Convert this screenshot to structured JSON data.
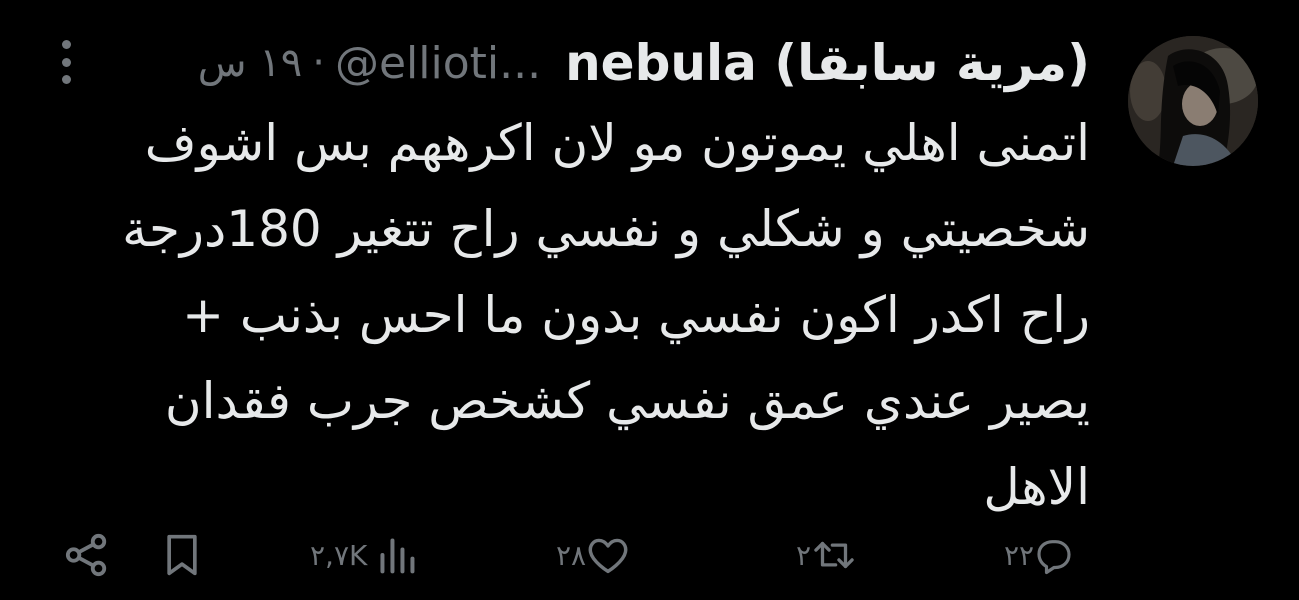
{
  "tweet": {
    "display_name": "nebula (مرية سابقا)",
    "handle": "@ellioti...",
    "separator": "·",
    "time": "١٩ س",
    "body_lines": [
      "اتمنى اهلي يموتون مو لان اكرههم بس اشوف",
      "شخصيتي و شكلي و نفسي راح تتغير 180درجة",
      "راح اكدر اكون نفسي بدون ما احس بذنب +",
      "يصير عندي عمق نفسي كشخص جرب فقدان",
      "الاهل"
    ]
  },
  "actions": {
    "replies": "٢٢",
    "retweets": "٢",
    "likes": "٢٨",
    "views": "٢,٧K"
  },
  "icons": {
    "reply": "reply-icon",
    "retweet": "retweet-icon",
    "like": "heart-icon",
    "views": "analytics-icon",
    "bookmark": "bookmark-icon",
    "share": "share-icon",
    "more": "more-icon"
  },
  "colors": {
    "background": "#000000",
    "text": "#e7e9ea",
    "secondary": "#71767b"
  }
}
